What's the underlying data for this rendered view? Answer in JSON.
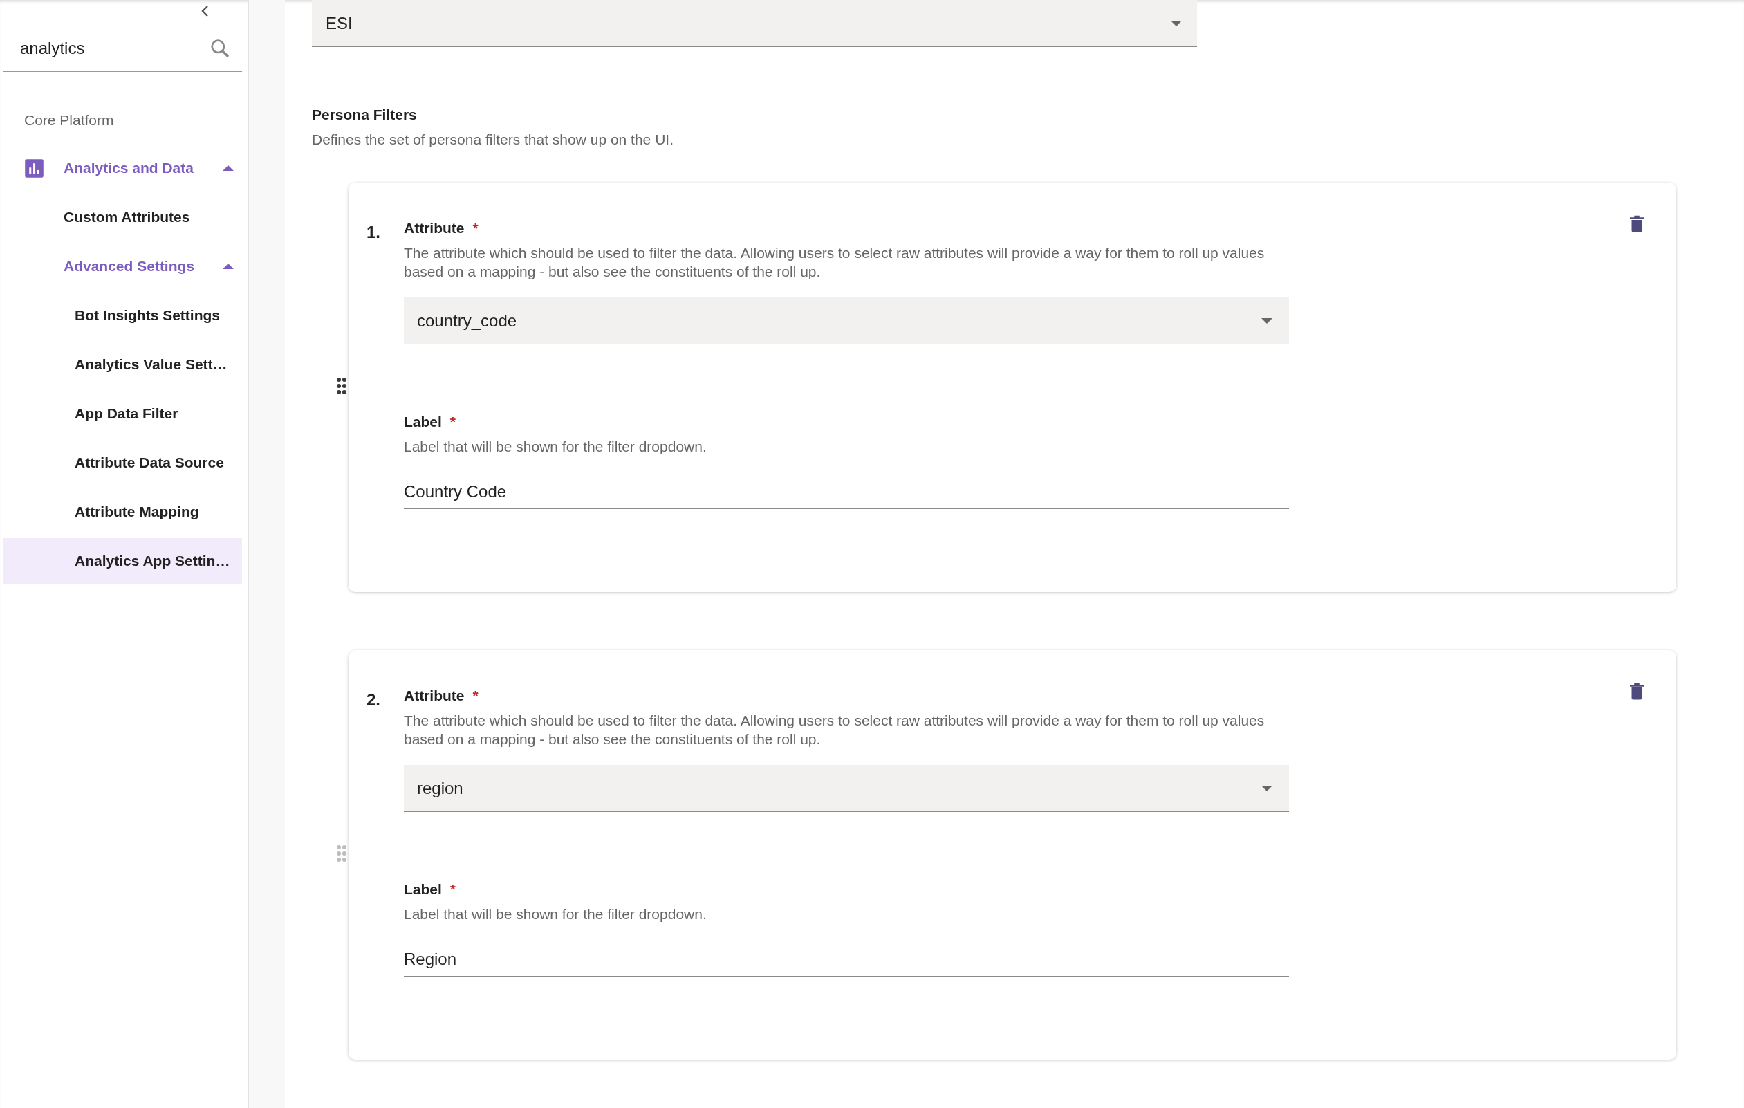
{
  "sidebar": {
    "search": {
      "value": "analytics"
    },
    "section_label": "Core Platform",
    "items": [
      {
        "label": "Analytics and Data",
        "selected": false,
        "expanded": true,
        "children": [
          {
            "label": "Custom Attributes",
            "selected": false
          },
          {
            "label": "Advanced Settings",
            "selected": false,
            "expanded": true,
            "children": [
              {
                "label": "Bot Insights Settings",
                "selected": false
              },
              {
                "label": "Analytics Value Sett…",
                "selected": false
              },
              {
                "label": "App Data Filter",
                "selected": false
              },
              {
                "label": "Attribute Data Source",
                "selected": false
              },
              {
                "label": "Attribute Mapping",
                "selected": false
              },
              {
                "label": "Analytics App Settin…",
                "selected": true
              }
            ]
          }
        ]
      }
    ]
  },
  "top_select": {
    "value": "ESI"
  },
  "persona_filters": {
    "title": "Persona Filters",
    "description": "Defines the set of persona filters that show up on the UI.",
    "filters": [
      {
        "number": "1.",
        "drag_handle_highlighted": true,
        "attribute": {
          "label": "Attribute",
          "required_mark": "*",
          "description": "The attribute which should be used to filter the data. Allowing users to select raw attributes will provide a way for them to roll up values based on a mapping - but also see the constituents of the roll up.",
          "value": "country_code"
        },
        "label_field": {
          "label": "Label",
          "required_mark": "*",
          "description": "Label that will be shown for the filter dropdown.",
          "value": "Country Code"
        }
      },
      {
        "number": "2.",
        "drag_handle_highlighted": false,
        "attribute": {
          "label": "Attribute",
          "required_mark": "*",
          "description": "The attribute which should be used to filter the data. Allowing users to select raw attributes will provide a way for them to roll up values based on a mapping - but also see the constituents of the roll up.",
          "value": "region"
        },
        "label_field": {
          "label": "Label",
          "required_mark": "*",
          "description": "Label that will be shown for the filter dropdown.",
          "value": "Region"
        }
      }
    ]
  }
}
